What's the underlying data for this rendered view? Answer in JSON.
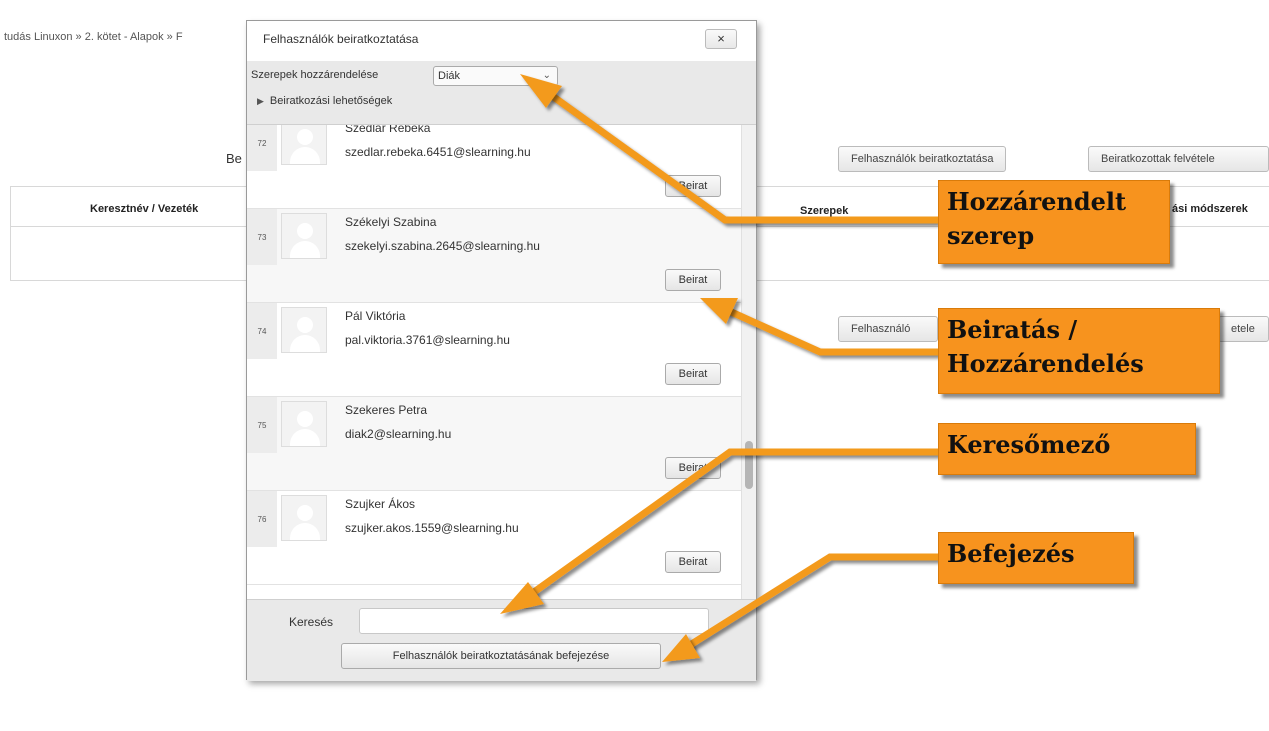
{
  "background": {
    "breadcrumb": "tudás Linuxon » 2. kötet - Alapok » F",
    "heading": "Be",
    "enrol_users_button": "Felhasználók beiratkoztatása",
    "enrolled_add_button": "Beiratkozottak felvétele",
    "enrol_users_button_short": "Felhasználó",
    "enrolled_add_button_short": "etele",
    "table_headers": {
      "name": "Keresztnév / Vezeték",
      "roles": "Szerepek",
      "methods": "ási módszerek"
    }
  },
  "modal": {
    "title": "Felhasználók beiratkoztatása",
    "close_label": "×",
    "role_label": "Szerepek hozzárendelése",
    "role_selected": "Diák",
    "enrol_options_label": "Beiratkozási lehetőségek",
    "users": [
      {
        "num": "72",
        "name": "Szedlár Rebeka",
        "email": "szedlar.rebeka.6451@slearning.hu",
        "button": "Beirat"
      },
      {
        "num": "73",
        "name": "Székelyi Szabina",
        "email": "szekelyi.szabina.2645@slearning.hu",
        "button": "Beirat"
      },
      {
        "num": "74",
        "name": "Pál Viktória",
        "email": "pal.viktoria.3761@slearning.hu",
        "button": "Beirat"
      },
      {
        "num": "75",
        "name": "Szekeres Petra",
        "email": "diak2@slearning.hu",
        "button": "Beirat"
      },
      {
        "num": "76",
        "name": "Szujker Ákos",
        "email": "szujker.akos.1559@slearning.hu",
        "button": "Beirat"
      }
    ],
    "search_label": "Keresés",
    "search_value": "",
    "finish_button": "Felhasználók beiratkoztatásának befejezése"
  },
  "callouts": {
    "role": "Hozzárendelt szerep",
    "enrol": "Beiratás / Hozzárendelés",
    "search": "Keresőmező",
    "finish": "Befejezés"
  },
  "colors": {
    "callout": "#f7931e",
    "arrow": "#f39a1f"
  }
}
